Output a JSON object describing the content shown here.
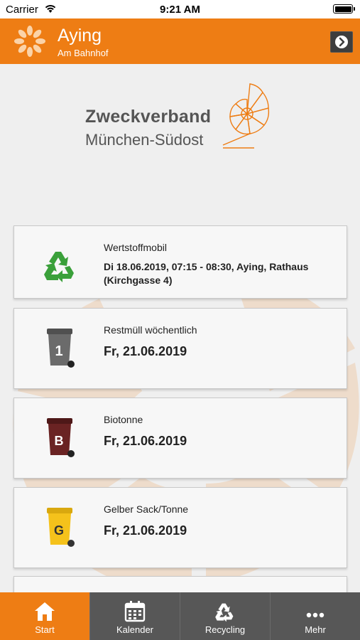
{
  "status": {
    "carrier": "Carrier",
    "time": "9:21 AM"
  },
  "header": {
    "title": "Aying",
    "subtitle": "Am Bahnhof"
  },
  "brand": {
    "line1": "Zweckverband",
    "line2": "München-Südost"
  },
  "cards": [
    {
      "label": "Wertstoffmobil",
      "date": "Di 18.06.2019, 07:15 - 08:30, Aying, Rathaus (Kirchgasse 4)",
      "icon": "recycle-icon"
    },
    {
      "label": "Restmüll wöchentlich",
      "date": "Fr, 21.06.2019",
      "icon": "gray-bin-icon",
      "bin_letter": "1",
      "bin_color": "#6b6b6b"
    },
    {
      "label": "Biotonne",
      "date": "Fr, 21.06.2019",
      "icon": "brown-bin-icon",
      "bin_letter": "B",
      "bin_color": "#6a2323"
    },
    {
      "label": "Gelber Sack/Tonne",
      "date": "Fr, 21.06.2019",
      "icon": "yellow-bin-icon",
      "bin_letter": "G",
      "bin_color": "#f5c21b"
    }
  ],
  "tabs": [
    {
      "label": "Start",
      "icon": "home-icon",
      "active": true
    },
    {
      "label": "Kalender",
      "icon": "calendar-icon",
      "active": false
    },
    {
      "label": "Recycling",
      "icon": "recycle-icon",
      "active": false
    },
    {
      "label": "Mehr",
      "icon": "more-icon",
      "active": false
    }
  ],
  "colors": {
    "accent": "#ee7d14",
    "tabbar": "#575757",
    "recycle_green": "#3aa03a"
  }
}
